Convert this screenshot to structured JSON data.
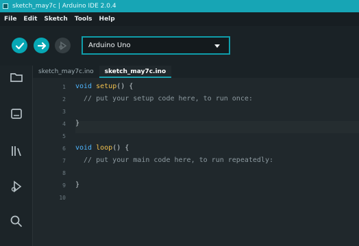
{
  "window": {
    "title": "sketch_may7c | Arduino IDE 2.0.4"
  },
  "menu": {
    "items": [
      "File",
      "Edit",
      "Sketch",
      "Tools",
      "Help"
    ]
  },
  "toolbar": {
    "board": "Arduino Uno"
  },
  "tabs": [
    {
      "label": "sketch_may7c.ino"
    },
    {
      "label": "sketch_may7c.ino"
    }
  ],
  "editor": {
    "line_numbers": [
      "1",
      "2",
      "3",
      "4",
      "5",
      "6",
      "7",
      "8",
      "9",
      "10"
    ],
    "lines": [
      {
        "kw": "void",
        "fn": "setup",
        "rest": "() {"
      },
      {
        "comment": "  // put your setup code here, to run once:"
      },
      {
        "text": ""
      },
      {
        "text": "}"
      },
      {
        "text": ""
      },
      {
        "kw": "void",
        "fn": "loop",
        "rest": "() {"
      },
      {
        "comment": "  // put your main code here, to run repeatedly:"
      },
      {
        "text": ""
      },
      {
        "text": "}"
      },
      {
        "text": ""
      }
    ]
  },
  "colors": {
    "accent": "#18a4b2",
    "background": "#1d2327"
  },
  "icons": [
    "verify-icon",
    "upload-icon",
    "debug-icon",
    "folder-icon",
    "board-manager-icon",
    "library-icon",
    "debug-sidebar-icon",
    "search-icon",
    "chevron-down-icon"
  ]
}
